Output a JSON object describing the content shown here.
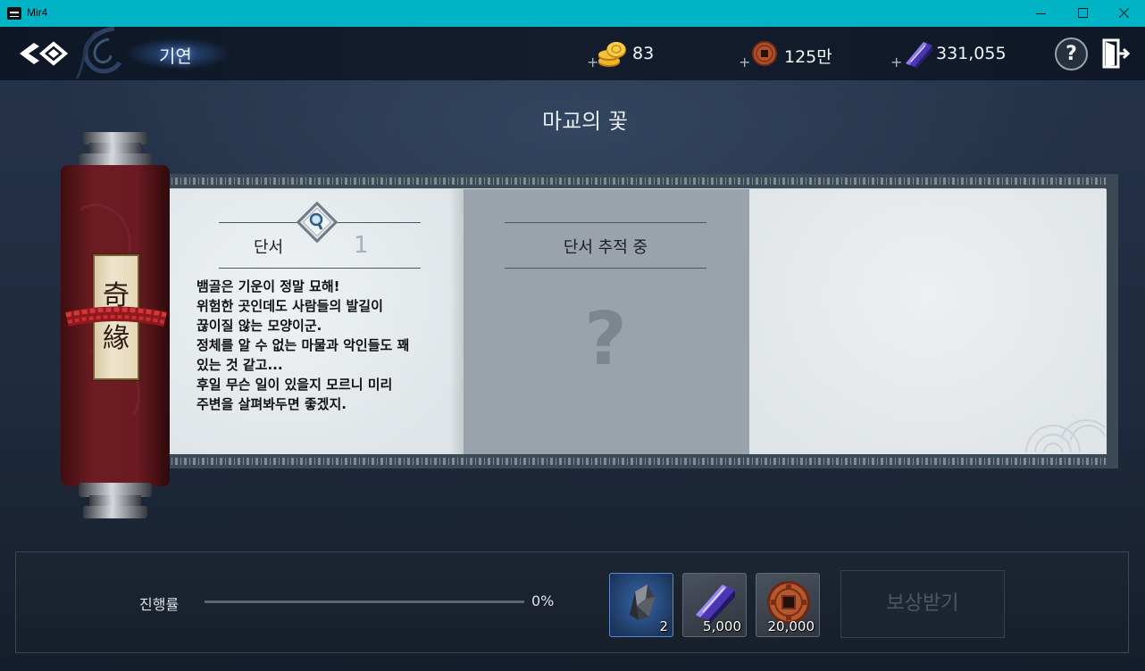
{
  "window": {
    "title": "Mir4"
  },
  "header": {
    "title": "기연",
    "back_icon": "back-arrow-icon",
    "currencies": [
      {
        "icon": "gold-coins-icon",
        "plus": "+",
        "value": "83"
      },
      {
        "icon": "copper-coin-icon",
        "plus": "+",
        "value": "125만"
      },
      {
        "icon": "darksteel-icon",
        "plus": "+",
        "value": "331,055"
      }
    ],
    "help_label": "?",
    "exit_icon": "exit-door-icon"
  },
  "quest": {
    "title": "마교의 꽃"
  },
  "scroll": {
    "label": [
      "奇",
      "緣"
    ]
  },
  "cards": {
    "clue": {
      "title": "단서",
      "count": "1",
      "icon": "magnifier-icon",
      "lines": [
        "뱀골은 기운이 정말 묘해!",
        "위험한 곳인데도 사람들의 발길이",
        "끊이질 않는 모양이군.",
        "정체를 알 수 없는 마물과 악인들도 꽤",
        "있는 것 같고...",
        "후일 무슨 일이 있을지 모르니 미리",
        "주변을 살펴봐두면 좋겠지."
      ]
    },
    "tracking": {
      "title": "단서 추적 중",
      "mark": "?"
    }
  },
  "progress": {
    "label": "진행률",
    "percent": "0%",
    "fraction": 0
  },
  "rewards": [
    {
      "icon": "stone-icon",
      "quantity": "2",
      "selected": true
    },
    {
      "icon": "darksteel-icon",
      "quantity": "5,000",
      "selected": false
    },
    {
      "icon": "copper-coin-icon",
      "quantity": "20,000",
      "selected": false
    }
  ],
  "claim_button": {
    "label": "보상받기",
    "enabled": false
  },
  "colors": {
    "title_bar": "#00b4c6",
    "header_bg": "#101a28",
    "panel_paper": "#e1e6e9",
    "tracking_card": "#9aa2ab",
    "selected_slot_border": "#5a8ad0",
    "disabled_button_text": "#4d5763"
  }
}
